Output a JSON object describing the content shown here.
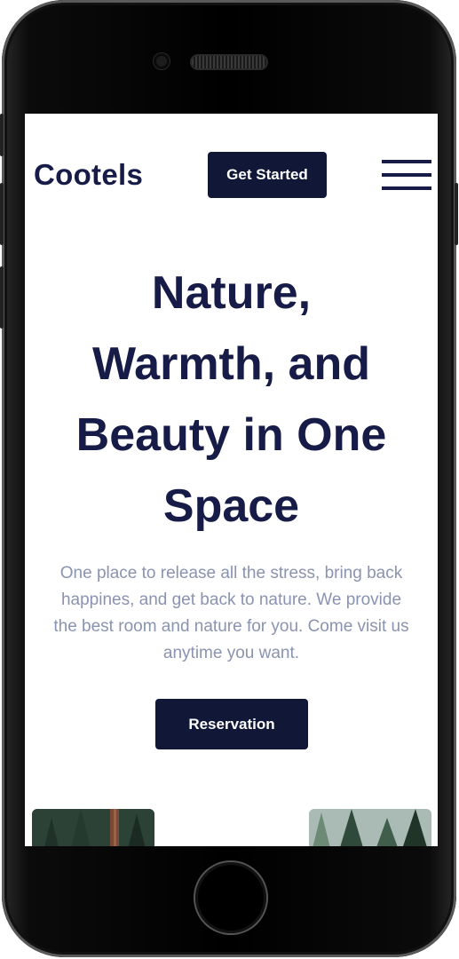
{
  "brand": {
    "name": "Cootels"
  },
  "header": {
    "cta_label": "Get Started",
    "menu_icon": "hamburger-menu-icon"
  },
  "hero": {
    "title_lines": [
      "Nature,",
      "Warmth, and",
      "Beauty in One",
      "Space"
    ],
    "description_lines": [
      "One place to release all the stress, bring back",
      "happines, and get back to nature. We provide",
      "the best room and nature for you. Come visit us",
      "anytime you want."
    ],
    "button_label": "Reservation"
  },
  "colors": {
    "primary": "#161b47",
    "button_bg": "#101737",
    "text_muted": "#8a93b0",
    "background": "#ffffff"
  }
}
